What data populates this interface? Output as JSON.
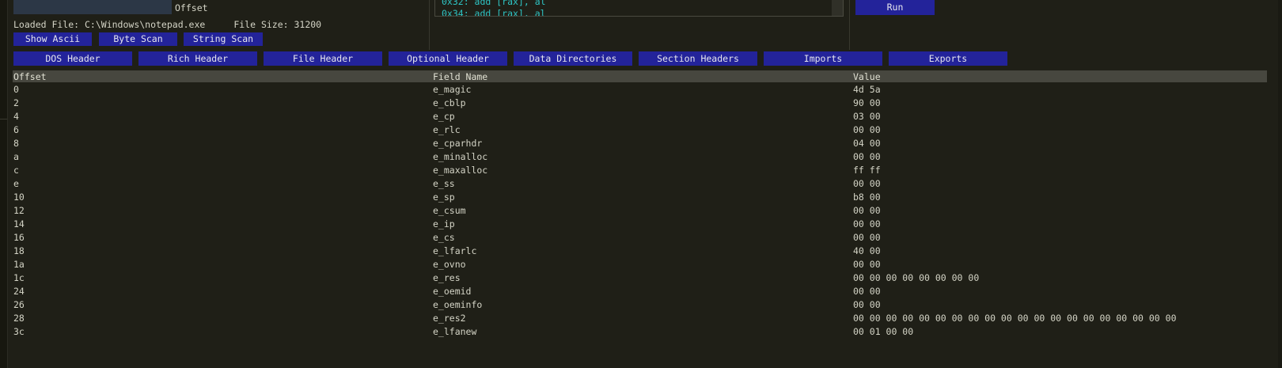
{
  "header": {
    "offset_label": "Offset",
    "loaded_file": "Loaded File: C:\\Windows\\notepad.exe",
    "file_size": "File Size: 31200"
  },
  "buttons": {
    "show_ascii": "Show Ascii",
    "byte_scan": "Byte Scan",
    "string_scan": "String Scan",
    "run": "Run"
  },
  "disassembly": {
    "lines": [
      "0x32: add [rax], al",
      "0x34: add [rax], al"
    ]
  },
  "tabs": [
    {
      "label": "DOS Header"
    },
    {
      "label": "Rich Header"
    },
    {
      "label": "File Header"
    },
    {
      "label": "Optional Header"
    },
    {
      "label": "Data Directories"
    },
    {
      "label": "Section Headers"
    },
    {
      "label": "Imports"
    },
    {
      "label": "Exports"
    }
  ],
  "table": {
    "columns": [
      "Offset",
      "Field Name",
      "Value"
    ],
    "rows": [
      {
        "offset": "0",
        "field": "e_magic",
        "value": "4d 5a"
      },
      {
        "offset": "2",
        "field": "e_cblp",
        "value": "90 00"
      },
      {
        "offset": "4",
        "field": "e_cp",
        "value": "03 00"
      },
      {
        "offset": "6",
        "field": "e_rlc",
        "value": "00 00"
      },
      {
        "offset": "8",
        "field": "e_cparhdr",
        "value": "04 00"
      },
      {
        "offset": "a",
        "field": "e_minalloc",
        "value": "00 00"
      },
      {
        "offset": "c",
        "field": "e_maxalloc",
        "value": "ff ff"
      },
      {
        "offset": "e",
        "field": "e_ss",
        "value": "00 00"
      },
      {
        "offset": "10",
        "field": "e_sp",
        "value": "b8 00"
      },
      {
        "offset": "12",
        "field": "e_csum",
        "value": "00 00"
      },
      {
        "offset": "14",
        "field": "e_ip",
        "value": "00 00"
      },
      {
        "offset": "16",
        "field": "e_cs",
        "value": "00 00"
      },
      {
        "offset": "18",
        "field": "e_lfarlc",
        "value": "40 00"
      },
      {
        "offset": "1a",
        "field": "e_ovno",
        "value": "00 00"
      },
      {
        "offset": "1c",
        "field": "e_res",
        "value": "00 00 00 00 00 00 00 00"
      },
      {
        "offset": "24",
        "field": "e_oemid",
        "value": "00 00"
      },
      {
        "offset": "26",
        "field": "e_oeminfo",
        "value": "00 00"
      },
      {
        "offset": "28",
        "field": "e_res2",
        "value": "00 00 00 00 00 00 00 00 00 00 00 00 00 00 00 00 00 00 00 00"
      },
      {
        "offset": "3c",
        "field": "e_lfanew",
        "value": "00 01 00 00"
      }
    ]
  },
  "colors": {
    "background": "#1f1f17",
    "button": "#23239a",
    "header_row": "#47473f",
    "disasm_text": "#2ec4c4"
  }
}
